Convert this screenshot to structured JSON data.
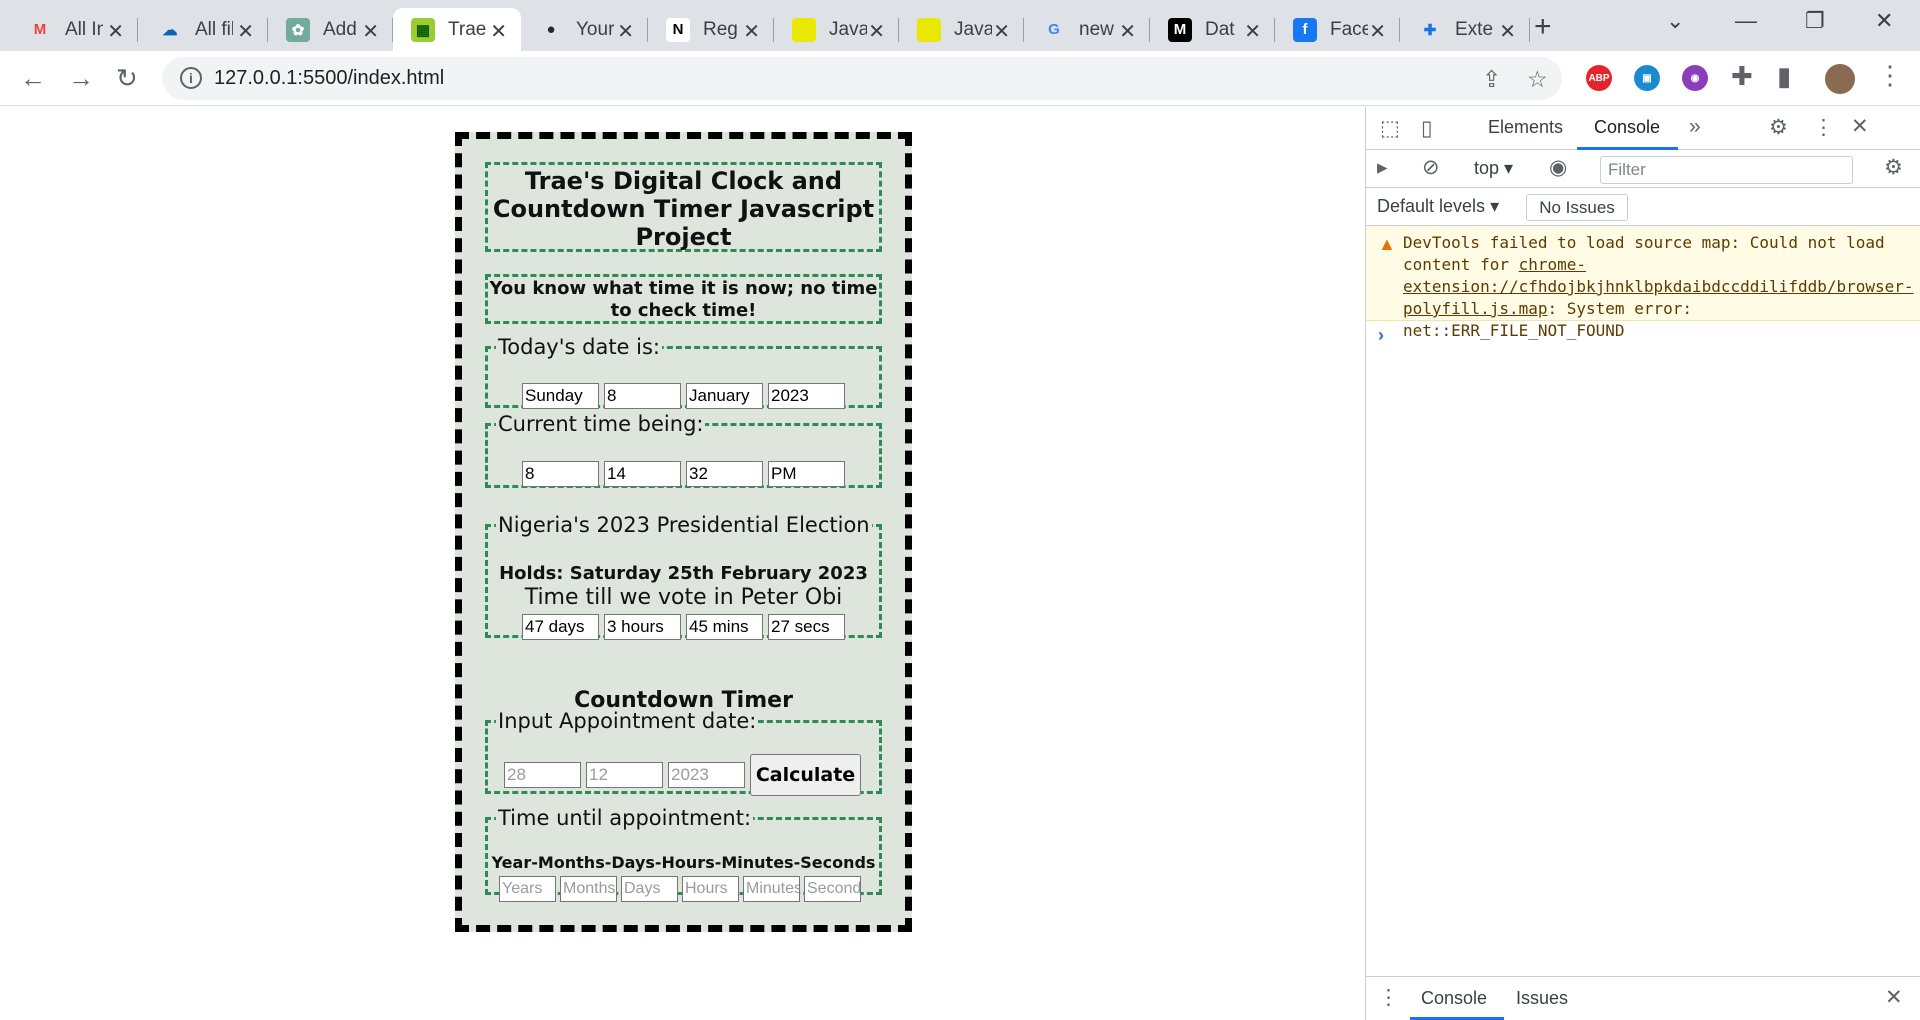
{
  "browser": {
    "tabs": [
      {
        "title": "All Inbox",
        "icon": "gmail-icon",
        "fav_text": "M",
        "fav_color": "#ea4335",
        "fav_bg": "transparent"
      },
      {
        "title": "All files",
        "icon": "onedrive-icon",
        "fav_text": "☁",
        "fav_color": "#0364b8",
        "fav_bg": "transparent"
      },
      {
        "title": "Add",
        "icon": "chatgpt-icon",
        "fav_text": "✿",
        "fav_color": "#fff",
        "fav_bg": "#74aa9c"
      },
      {
        "title": "Trae's",
        "icon": "qr-icon",
        "fav_text": "▦",
        "fav_color": "#0a5c0a",
        "fav_bg": "#9acd32",
        "active": true
      },
      {
        "title": "Your",
        "icon": "github-icon",
        "fav_text": "●",
        "fav_color": "#24292f",
        "fav_bg": "transparent"
      },
      {
        "title": "Reg",
        "icon": "notion-icon",
        "fav_text": "N",
        "fav_color": "#000",
        "fav_bg": "#fff"
      },
      {
        "title": "Java",
        "icon": "javascript-icon",
        "fav_text": "",
        "fav_color": "#000",
        "fav_bg": "#e8e800"
      },
      {
        "title": "Java",
        "icon": "javascript-icon",
        "fav_text": "",
        "fav_color": "#000",
        "fav_bg": "#e8e800"
      },
      {
        "title": "new",
        "icon": "google-icon",
        "fav_text": "G",
        "fav_color": "#4285f4",
        "fav_bg": "transparent"
      },
      {
        "title": "Dat",
        "icon": "medium-icon",
        "fav_text": "M",
        "fav_color": "#fff",
        "fav_bg": "#000"
      },
      {
        "title": "Face",
        "icon": "facebook-icon",
        "fav_text": "f",
        "fav_color": "#fff",
        "fav_bg": "#1877f2"
      },
      {
        "title": "Exte",
        "icon": "puzzle-icon",
        "fav_text": "✚",
        "fav_color": "#1a73e8",
        "fav_bg": "transparent"
      }
    ],
    "url": "127.0.0.1:5500/index.html",
    "extensions": [
      {
        "name": "adblock-icon",
        "text": "ABP",
        "color": "#e8222a"
      },
      {
        "name": "screen-capture-icon",
        "text": "▣",
        "color": "#1a8bd1"
      },
      {
        "name": "color-picker-icon",
        "text": "◉",
        "color": "#8b3dbb"
      }
    ]
  },
  "app": {
    "title": "Trae's Digital Clock and Countdown Timer Javascript Project",
    "subtitle": "You know what time it is now; no time to check time!",
    "date_legend": "Today's date is:",
    "date_values": [
      "Sunday",
      "8",
      "January",
      "2023"
    ],
    "time_legend": "Current time being:",
    "time_values": [
      "8",
      "14",
      "32",
      "PM"
    ],
    "election_legend": "Nigeria's 2023 Presidential Election",
    "election_holds": "Holds: Saturday 25th February 2023",
    "election_tagline": "Time till we vote in Peter Obi",
    "election_values": [
      "47 days",
      "3 hours",
      "45 mins",
      "27 secs"
    ],
    "countdown_heading": "Countdown Timer",
    "appointment_legend": "Input Appointment date:",
    "appointment_placeholders": [
      "28",
      "12",
      "2023"
    ],
    "calculate_label": "Calculate",
    "until_legend": "Time until appointment:",
    "until_caption": "Year-Months-Days-Hours-Minutes-Seconds",
    "until_placeholders": [
      "Years",
      "Months",
      "Days",
      "Hours",
      "Minutes",
      "Seconds"
    ]
  },
  "devtools": {
    "tabs": [
      "Elements",
      "Console"
    ],
    "active_tab": "Console",
    "context": "top",
    "filter_placeholder": "Filter",
    "levels": "Default levels",
    "issues": "No Issues",
    "warning_pre": "DevTools failed to load source map: Could not load content for ",
    "warning_link": "chrome-extension://cfhdojbkjhnklbpkdaibdccddilifddb/browser-polyfill.js.map",
    "warning_post": ": System error: net::ERR_FILE_NOT_FOUND",
    "drawer_tabs": [
      "Console",
      "Issues"
    ]
  }
}
